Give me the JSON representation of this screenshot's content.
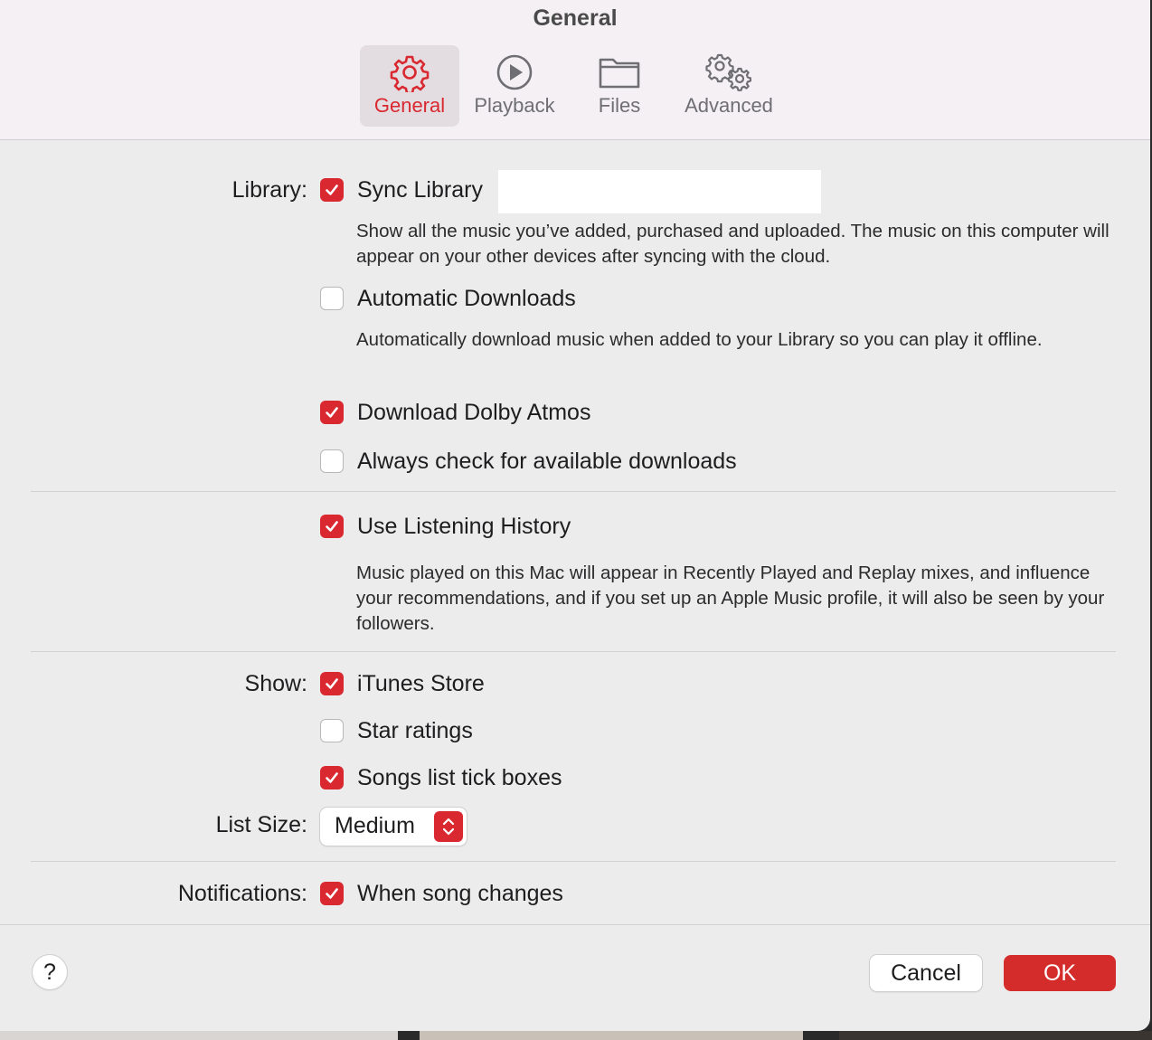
{
  "window": {
    "title": "General"
  },
  "tabs": [
    {
      "label": "General",
      "icon": "gear-icon",
      "active": true
    },
    {
      "label": "Playback",
      "icon": "play-circle-icon",
      "active": false
    },
    {
      "label": "Files",
      "icon": "folder-icon",
      "active": false
    },
    {
      "label": "Advanced",
      "icon": "gears-icon",
      "active": false
    }
  ],
  "library": {
    "label": "Library:",
    "sync_library": {
      "label": "Sync Library",
      "checked": true,
      "description": "Show all the music you’ve added, purchased and uploaded. The music on this computer will appear on your other devices after syncing with the cloud."
    },
    "automatic_downloads": {
      "label": "Automatic Downloads",
      "checked": false,
      "description": "Automatically download music when added to your Library so you can play it offline."
    },
    "download_dolby_atmos": {
      "label": "Download Dolby Atmos",
      "checked": true
    },
    "always_check": {
      "label": "Always check for available downloads",
      "checked": false
    }
  },
  "history": {
    "use_listening_history": {
      "label": "Use Listening History",
      "checked": true,
      "description": "Music played on this Mac will appear in Recently Played and Replay mixes, and influence your recommendations, and if you set up an Apple Music profile, it will also be seen by your followers."
    }
  },
  "show": {
    "label": "Show:",
    "itunes_store": {
      "label": "iTunes Store",
      "checked": true
    },
    "star_ratings": {
      "label": "Star ratings",
      "checked": false
    },
    "songs_list_tick_boxes": {
      "label": "Songs list tick boxes",
      "checked": true
    }
  },
  "list_size": {
    "label": "List Size:",
    "value": "Medium"
  },
  "notifications": {
    "label": "Notifications:",
    "when_song_changes": {
      "label": "When song changes",
      "checked": true
    }
  },
  "footer": {
    "help_label": "?",
    "cancel_label": "Cancel",
    "ok_label": "OK"
  },
  "colors": {
    "accent": "#d9282f",
    "window_bg": "#ececec",
    "toolbar_bg": "#f4f0f3"
  }
}
